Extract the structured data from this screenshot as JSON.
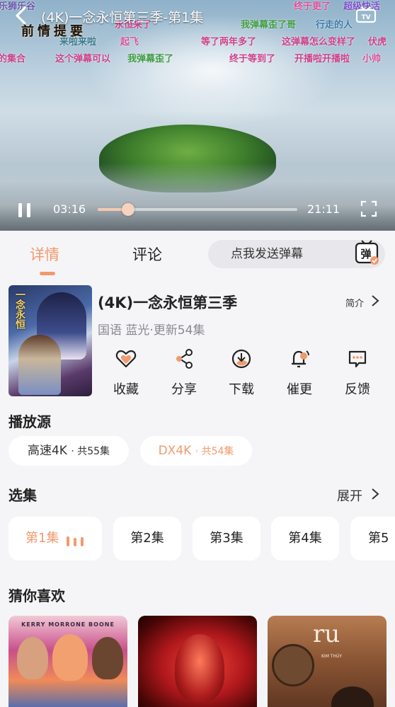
{
  "player": {
    "title": "(4K)一念永恒第三季-第1集",
    "logo_text": "前情提要",
    "current_time": "03:16",
    "total_time": "21:11",
    "progress": 0.154,
    "danmaku": [
      "乐狮乐谷",
      "终于更了",
      "超级快活",
      "永恒来了",
      "来啦来啦",
      "我弹幕歪了哥",
      "行走的人",
      "起飞",
      "等了两年多了",
      "这弹幕怎么变样了",
      "伏虎",
      "来的集合",
      "这个弹幕可以",
      "我弹幕歪了",
      "终于等到了",
      "开播啦开播啦",
      "小帅"
    ]
  },
  "tabs": {
    "details": "详情",
    "comments": "评论",
    "danmaku_placeholder": "点我发送弹幕",
    "danmaku_toggle": "弹"
  },
  "show": {
    "title": "(4K)一念永恒第三季",
    "intro_label": "简介",
    "meta": "国语 蓝光·更新54集",
    "poster_text": "一念永恒",
    "actions": [
      {
        "label": "收藏",
        "icon": "heart-icon"
      },
      {
        "label": "分享",
        "icon": "share-icon"
      },
      {
        "label": "下载",
        "icon": "download-icon"
      },
      {
        "label": "催更",
        "icon": "bell-icon"
      },
      {
        "label": "反馈",
        "icon": "feedback-icon"
      }
    ]
  },
  "sources": {
    "title": "播放源",
    "items": [
      {
        "name": "高速4K",
        "count": "· 共55集"
      },
      {
        "name": "DX4K",
        "count": "· 共54集"
      }
    ]
  },
  "episodes": {
    "title": "选集",
    "expand_label": "展开",
    "items": [
      "第1集",
      "第2集",
      "第3集",
      "第4集",
      "第5"
    ]
  },
  "recommend": {
    "title": "猜你喜欢",
    "items": [
      {
        "poster_text": "KERRY  MORRONE  BOONE"
      },
      {
        "poster_text": ""
      },
      {
        "poster_text": "ru",
        "poster_small": "KIM THÚY"
      }
    ]
  },
  "colors": {
    "accent": "#f19a6d",
    "page_bg": "#f5f5f7",
    "chip_bg": "#ffffff"
  }
}
